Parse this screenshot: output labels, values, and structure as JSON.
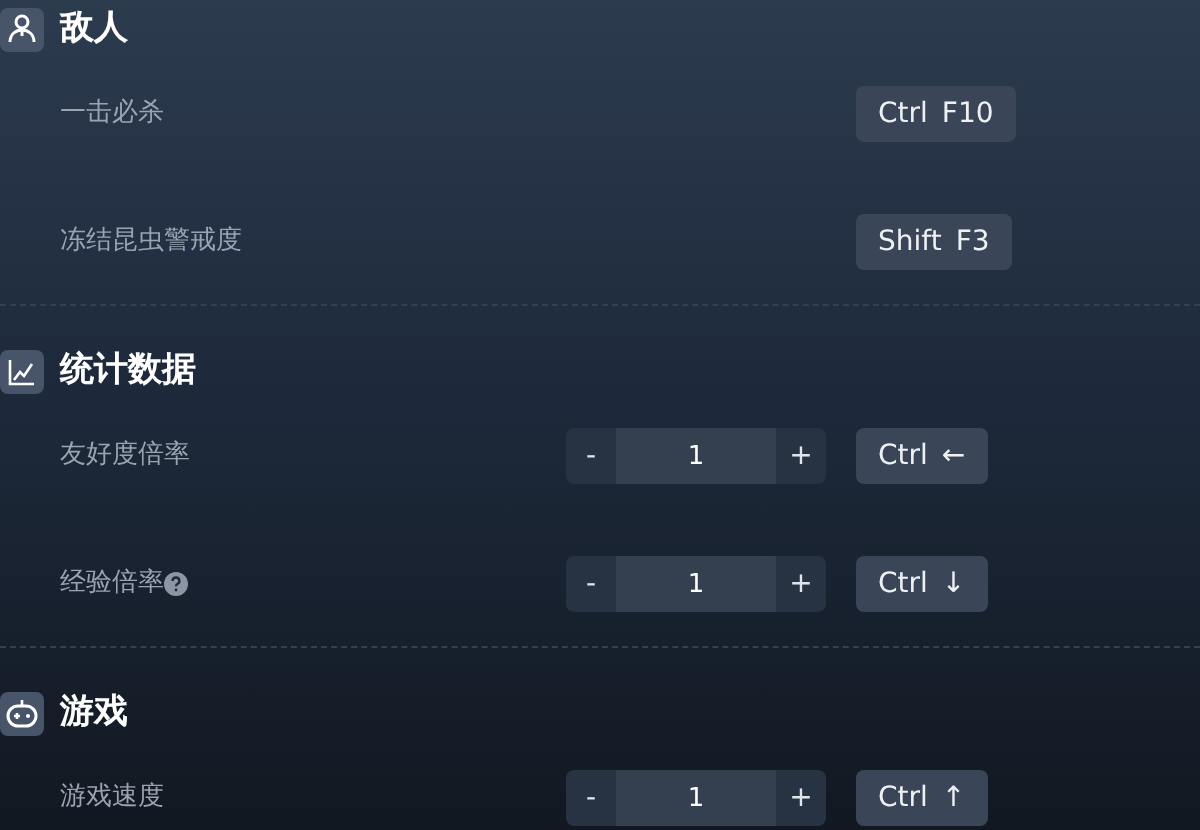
{
  "sections": [
    {
      "title": "敌人",
      "rows": [
        {
          "kind": "hotkey",
          "label": "一击必杀",
          "help": false,
          "keys": [
            "Ctrl",
            "F10"
          ]
        },
        {
          "kind": "hotkey",
          "label": "冻结昆虫警戒度",
          "help": false,
          "keys": [
            "Shift",
            "F3"
          ]
        }
      ]
    },
    {
      "title": "统计数据",
      "rows": [
        {
          "kind": "stepper",
          "label": "友好度倍率",
          "help": false,
          "minus": "-",
          "value": "1",
          "plus": "+",
          "keys": [
            "Ctrl",
            "←"
          ]
        },
        {
          "kind": "stepper",
          "label": "经验倍率",
          "help": true,
          "minus": "-",
          "value": "1",
          "plus": "+",
          "keys": [
            "Ctrl",
            "↓"
          ]
        }
      ]
    },
    {
      "title": "游戏",
      "rows": [
        {
          "kind": "stepper",
          "label": "游戏速度",
          "help": false,
          "minus": "-",
          "value": "1",
          "plus": "+",
          "keys": [
            "Ctrl",
            "↑"
          ]
        }
      ]
    }
  ]
}
